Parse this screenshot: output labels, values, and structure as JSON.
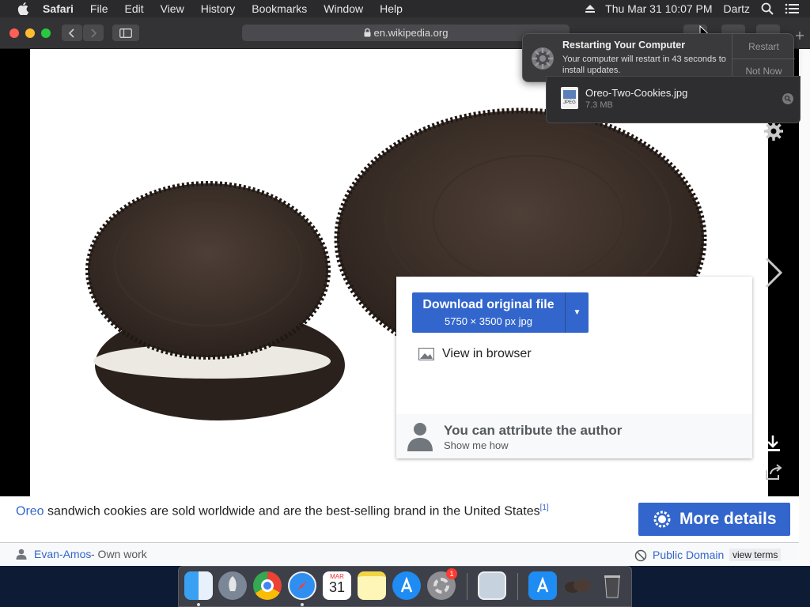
{
  "menubar": {
    "app": "Safari",
    "items": [
      "File",
      "Edit",
      "View",
      "History",
      "Bookmarks",
      "Window",
      "Help"
    ],
    "clock": "Thu Mar 31  10:07 PM",
    "user": "Dartz"
  },
  "browser": {
    "url": "en.wikipedia.org"
  },
  "notification": {
    "title": "Restarting Your Computer",
    "body": "Your computer will restart in 43 seconds to install updates.",
    "restart_label": "Restart",
    "notnow_label": "Not Now"
  },
  "download_item": {
    "filename": "Oreo-Two-Cookies.jpg",
    "size": "7.3 MB",
    "icon_label": "JPEG"
  },
  "download_panel": {
    "download_label": "Download original file",
    "download_sub": "5750 × 3500 px jpg",
    "view_label": "View in browser",
    "attr_title": "You can attribute the author",
    "attr_sub": "Show me how"
  },
  "caption": {
    "link": "Oreo",
    "text": " sandwich cookies are sold worldwide and are the best-selling brand in the United States",
    "ref": "[1]"
  },
  "more_details_label": "More details",
  "footer": {
    "author": "Evan-Amos",
    "author_suffix": " - Own work",
    "license": "Public Domain",
    "terms": "view terms"
  },
  "dock": {
    "calendar_month": "MAR",
    "calendar_day": "31",
    "settings_badge": "1"
  },
  "colors": {
    "wiki_blue": "#3366cc",
    "menubar": "#2a2a2d",
    "toolbar": "#333336"
  }
}
